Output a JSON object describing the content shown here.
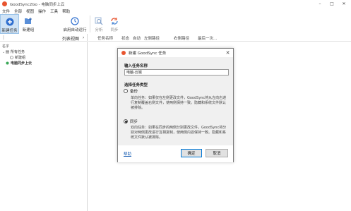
{
  "window": {
    "title": "GoodSync2Go - 电脑同步上云",
    "controls": {
      "minimize": "–",
      "maximize": "□",
      "close": "✕"
    }
  },
  "menu": {
    "items": [
      "文件",
      "全部",
      "视图",
      "操作",
      "工具",
      "帮助"
    ]
  },
  "toolbar": {
    "new_job": "新建任务",
    "new_group": "新建组",
    "enable_auto": "启用自动运行",
    "analyze": "分析",
    "sync": "同步"
  },
  "left_panel": {
    "tabs": {
      "first": "|",
      "list_view": "列表视图",
      "chevron": "›"
    },
    "tree_header": "名字",
    "tree": {
      "all_jobs": "所有任务",
      "new_group_item": "新建组",
      "current_job": "电脑同步上云"
    }
  },
  "columns": [
    "任务名称",
    "状态",
    "自动",
    "左侧路径",
    "右侧路径",
    "最后一次..."
  ],
  "dialog": {
    "title": "新建 GoodSync 任务",
    "close": "✕",
    "name_label": "输入任务名称",
    "name_value": "电脑-云端",
    "type_label": "选择任务类型",
    "backup_label": "备份",
    "backup_desc": "单向任务：如果仅在左侧更改文件，GoodSync将从左向右进行复制覆盖右侧文件，使两侧保持一致。隐藏和系统文件默认被排除。",
    "sync_label": "同步",
    "sync_desc": "双向任务：如果在同步的两侧分别更改文件，GoodSync将分别对两侧更改进行互相复制，使两侧内容保持一致。隐藏和系统文件默认被排除。",
    "selected_type": "sync",
    "help": "帮助",
    "ok": "确定",
    "cancel": "取消"
  },
  "colors": {
    "accent": "#0078d7",
    "brand": "#e8542f"
  }
}
